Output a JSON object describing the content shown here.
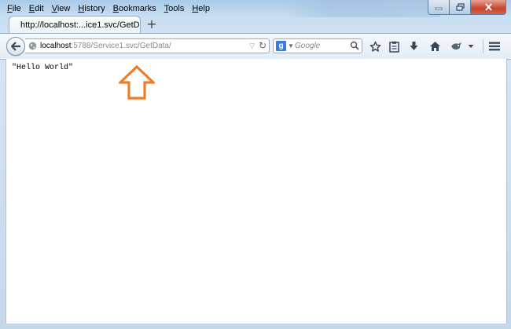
{
  "menu": [
    {
      "label": "File",
      "key": "F",
      "rest": "ile"
    },
    {
      "label": "Edit",
      "key": "E",
      "rest": "dit"
    },
    {
      "label": "View",
      "key": "V",
      "rest": "iew"
    },
    {
      "label": "History",
      "key": "H",
      "rest": "istory"
    },
    {
      "label": "Bookmarks",
      "key": "B",
      "rest": "ookmarks"
    },
    {
      "label": "Tools",
      "key": "T",
      "rest": "ools"
    },
    {
      "label": "Help",
      "key": "H",
      "rest": "elp"
    }
  ],
  "tab": {
    "title": "http://localhost:...ice1.svc/GetData/",
    "new_tab_symbol": "+"
  },
  "address": {
    "host": "localhost",
    "rest": ":5788/Service1.svc/GetData/"
  },
  "search": {
    "placeholder": "Google",
    "engine_letter": "g"
  },
  "toolbar": {
    "icons": [
      "bookmark-star-icon",
      "reading-list-icon",
      "downloads-icon",
      "home-icon",
      "addon-icon",
      "menu-icon"
    ]
  },
  "page": {
    "response_text": "\"Hello World\""
  },
  "annotation": {
    "arrow_color": "#f07c28"
  },
  "colors": {
    "close_button": "#c6442b",
    "search_engine": "#3a7be0"
  }
}
